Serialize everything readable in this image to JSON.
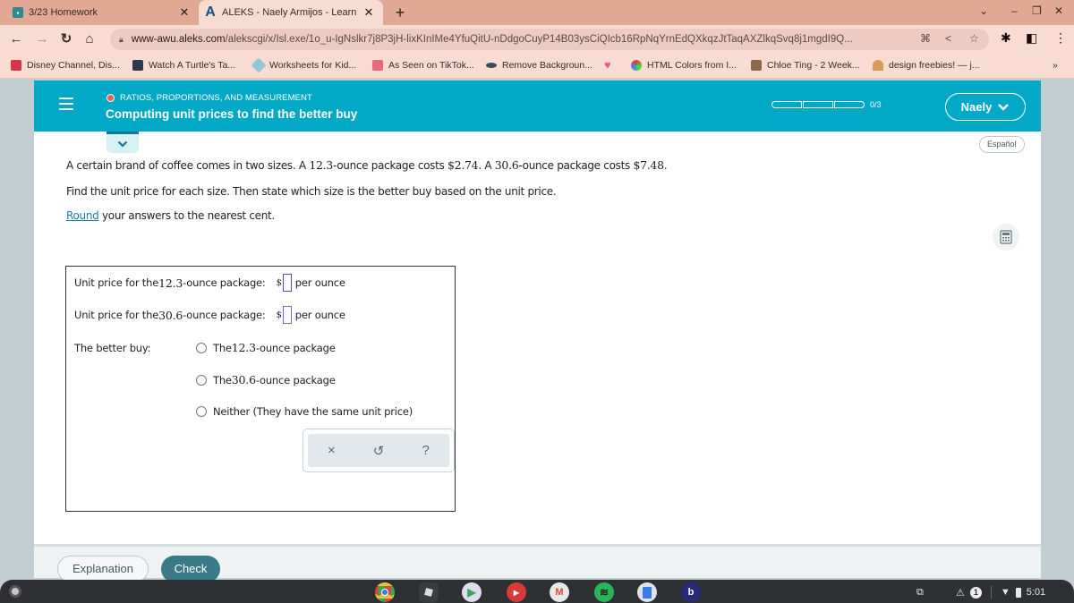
{
  "browser": {
    "tabs": [
      {
        "title": "3/23 Homework",
        "active": false,
        "favicon": "classroom-icon"
      },
      {
        "title": "ALEKS - Naely Armijos - Learn",
        "active": true,
        "favicon": "aleks-icon"
      }
    ],
    "new_tab_label": "+",
    "url_domain": "www-awu.aleks.com",
    "url_path": "/alekscgi/x/Isl.exe/1o_u-IgNslkr7j8P3jH-lixKInIMe4YfuQitU-nDdgoCuyP14B03ysCiQIcb16RpNqYrnEdQXkqzJtTaqAXZlkqSvq8j1mgdI9Q...",
    "bookmarks": [
      {
        "label": "Disney Channel, Dis...",
        "icon": "disney-icon",
        "color": "#d8344a"
      },
      {
        "label": "Watch A Turtle's Ta...",
        "icon": "tumblr-icon",
        "color": "#2c3a4a"
      },
      {
        "label": "Worksheets for Kid...",
        "icon": "tag-icon",
        "color": "#8fc8d8"
      },
      {
        "label": "As Seen on TikTok...",
        "icon": "tiktok-icon",
        "color": "#e86a7a"
      },
      {
        "label": "Remove Backgroun...",
        "icon": "remove-bg-icon",
        "color": "#3a4a5a"
      },
      {
        "label": "",
        "icon": "heart-icon",
        "color": "#e85a8a"
      },
      {
        "label": "HTML Colors from I...",
        "icon": "color-wheel-icon",
        "color": "#3a8ae8"
      },
      {
        "label": "Chloe Ting - 2 Week...",
        "icon": "chloe-ting-icon",
        "color": "#8a6a4a"
      },
      {
        "label": "design freebies! — j...",
        "icon": "rainbow-icon",
        "color": "#d89a5a"
      }
    ],
    "bookmarks_overflow": "»"
  },
  "aleks": {
    "topic_category": "RATIOS, PROPORTIONS, AND MEASUREMENT",
    "topic_title": "Computing unit prices to find the better buy",
    "progress": {
      "completed": 0,
      "total": 3,
      "label": "0/3"
    },
    "user_name": "Naely",
    "language_button": "Español",
    "colors": {
      "header": "#02a9c6",
      "check_button": "#3a7a86",
      "topic_dot": "#e8644a"
    },
    "question": {
      "line1_a": "A certain brand of coffee comes in two sizes. A ",
      "line1_n1": "12.3",
      "line1_b": "-ounce package costs ",
      "line1_n2": "$2.74",
      "line1_c": ". A ",
      "line1_n3": "30.6",
      "line1_d": "-ounce package costs ",
      "line1_n4": "$7.48",
      "line1_e": ".",
      "line2": "Find the unit price for each size. Then state which size is the better buy based on the unit price.",
      "line3_link": "Round",
      "line3_rest": " your answers to the nearest cent."
    },
    "answers": {
      "row1_a": "Unit price for the ",
      "row1_num": "12.3",
      "row1_b": "-ounce package:",
      "row1_value": "",
      "row2_a": "Unit price for the ",
      "row2_num": "30.6",
      "row2_b": "-ounce package:",
      "row2_value": "",
      "currency": "$",
      "unit_label": "per ounce",
      "better_buy_label": "The better buy:",
      "options": [
        {
          "a": "The ",
          "num": "12.3",
          "b": "-ounce package",
          "selected": false
        },
        {
          "a": "The ",
          "num": "30.6",
          "b": "-ounce package",
          "selected": false
        },
        {
          "a": "Neither (They have the same unit price)",
          "num": "",
          "b": "",
          "selected": false
        }
      ]
    },
    "tools": {
      "clear": "×",
      "undo": "↺",
      "help": "?"
    },
    "footer": {
      "explanation": "Explanation",
      "check": "Check"
    }
  },
  "os": {
    "shelf_apps": [
      "chrome-icon",
      "roblox-icon",
      "play-store-icon",
      "youtube-icon",
      "gmail-icon",
      "spotify-icon",
      "docs-icon",
      "b-app-icon"
    ],
    "notification_count": "1",
    "time": "5:01"
  }
}
